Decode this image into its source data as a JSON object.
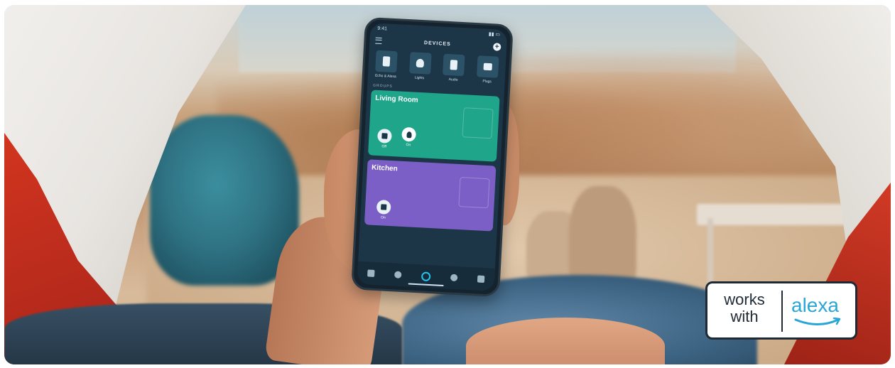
{
  "phone": {
    "status_time": "9:41",
    "app_title": "DEVICES",
    "categories": [
      {
        "label": "Echo & Alexa"
      },
      {
        "label": "Lights"
      },
      {
        "label": "Audio"
      },
      {
        "label": "Plugs"
      }
    ],
    "groups_label": "GROUPS",
    "groups": [
      {
        "name": "Living Room",
        "devices": [
          {
            "state": "Off"
          },
          {
            "state": "On"
          }
        ]
      },
      {
        "name": "Kitchen",
        "devices": [
          {
            "state": "On"
          }
        ]
      }
    ]
  },
  "badge": {
    "line1": "works",
    "line2": "with",
    "brand": "alexa"
  },
  "colors": {
    "living_room_card": "#1ea58a",
    "kitchen_card": "#7c5fc6",
    "alexa_blue": "#2aa6d6",
    "tent_red": "#c92d1f"
  }
}
